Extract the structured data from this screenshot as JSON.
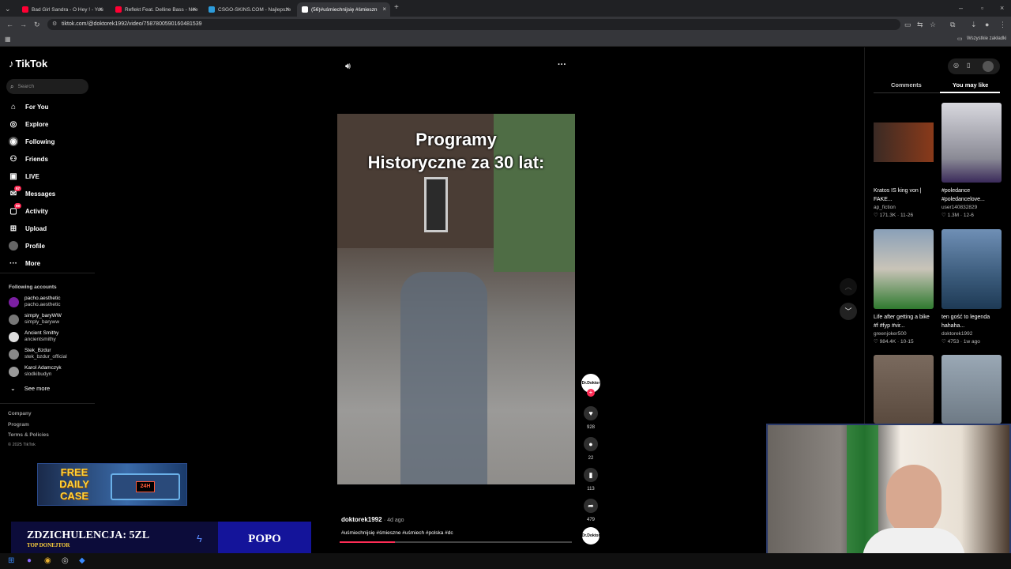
{
  "browser": {
    "tabs": [
      {
        "title": "Bad Girl Sandra - O Hey ! - You",
        "fav": "#ff0033"
      },
      {
        "title": "Reflekt Feat. Delline Bass - Nee",
        "fav": "#ff0033"
      },
      {
        "title": "CSGO-SKINS.COM - Najlepsze",
        "fav": "#2d9cdb"
      },
      {
        "title": "(56)#uśmiechnijsię #śmieszn",
        "fav": "#ffffff"
      }
    ],
    "url": "tiktok.com/@doktorek1992/video/7587800590160481539",
    "bookmarks_label": "Wszystkie zakładki",
    "new_tab": "+"
  },
  "tiktok": {
    "logo": "TikTok",
    "search_placeholder": "Search",
    "nav": [
      {
        "label": "For You",
        "icon": "home-icon"
      },
      {
        "label": "Explore",
        "icon": "compass-icon"
      },
      {
        "label": "Following",
        "icon": "following-icon"
      },
      {
        "label": "Friends",
        "icon": "friends-icon"
      },
      {
        "label": "LIVE",
        "icon": "live-icon"
      },
      {
        "label": "Messages",
        "icon": "messages-icon",
        "badge": "57"
      },
      {
        "label": "Activity",
        "icon": "activity-icon",
        "badge": "99"
      },
      {
        "label": "Upload",
        "icon": "upload-icon"
      },
      {
        "label": "Profile",
        "icon": "profile-icon"
      },
      {
        "label": "More",
        "icon": "more-icon"
      }
    ],
    "following_header": "Following accounts",
    "accounts": [
      {
        "name": "pacho.aesthetic",
        "user": "pacho.aesthetic",
        "color": "#7b1fa2"
      },
      {
        "name": "simply_baryWW",
        "user": "simply_baryww",
        "color": "#777"
      },
      {
        "name": "Ancient Smithy",
        "user": "ancientsmithy",
        "color": "#ddd"
      },
      {
        "name": "Stek_Bzdur",
        "user": "stek_bzdur_official",
        "color": "#888"
      },
      {
        "name": "Karol Adamczyk",
        "user": "slodkibudyn",
        "color": "#999"
      }
    ],
    "see_more": "See more",
    "footer": [
      "Company",
      "Program",
      "Terms & Policies",
      "© 2025 TikTok"
    ]
  },
  "video": {
    "overlay_title_line1": "Programy",
    "overlay_title_line2": "Historyczne za 30 lat:",
    "author": "doktorek1992",
    "age": "· 4d ago",
    "tags": "#uśmiechnijsię #śmieszne #uśmiech #polska #dc",
    "avatar_label": "Dr.Doktor",
    "likes": "928",
    "comments": "22",
    "saves": "113",
    "shares": "479"
  },
  "right_panel": {
    "tab_comments": "Comments",
    "tab_you_may_like": "You may like",
    "cards": [
      {
        "title": "Kratos IS king von | FAKE...",
        "user": "ap_fiction",
        "meta": "♡ 171.3K · 11-26",
        "color": "#3a2a24"
      },
      {
        "title": "#poledance #poledancelove...",
        "user": "user140832829",
        "meta": "♡ 1.3M · 12-6",
        "color": "#c9c9d0"
      },
      {
        "title": "Life after getting a bike #f #fyp #vir...",
        "user": "greenjoker500",
        "meta": "♡ 984.4K · 10-15",
        "color": "#8aa0b8"
      },
      {
        "title": "ten gość to legenda hahaha...",
        "user": "doktorek1992",
        "meta": "♡ 4753 · 1w ago",
        "color": "#6f8fb5"
      },
      {
        "title": "",
        "user": "",
        "meta": "",
        "color": "#5a4a3e"
      },
      {
        "title": "",
        "user": "",
        "meta": "",
        "color": "#6e7a85"
      }
    ]
  },
  "stream_overlay": {
    "promo_line1": "FREE",
    "promo_line2": "DAILY",
    "promo_line3": "CASE",
    "promo_box": "24H",
    "donor_title": "ZDZICHULENCJA: 5ZL",
    "donor_sub": "TOP DONEJTOR",
    "donor_name": "POPO"
  }
}
